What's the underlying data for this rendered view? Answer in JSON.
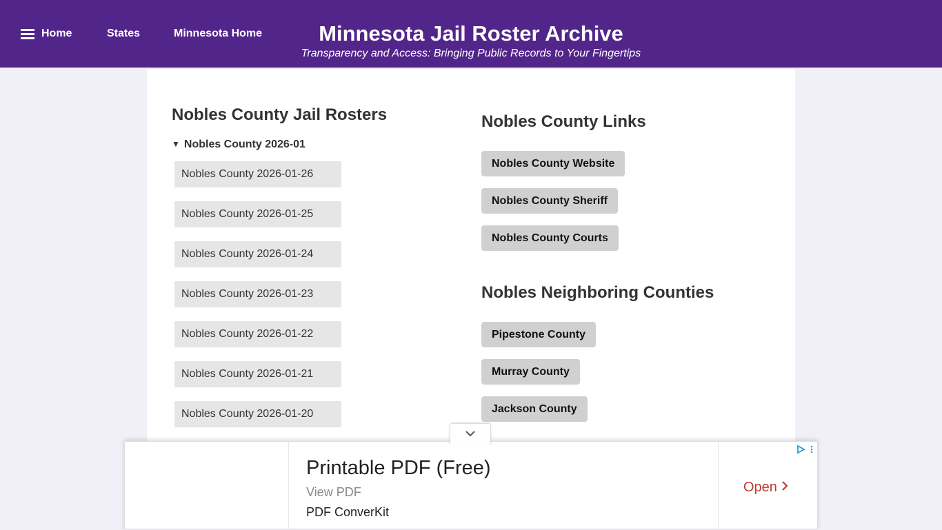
{
  "nav": {
    "home": "Home",
    "states": "States",
    "state_home": "Minnesota Home"
  },
  "header": {
    "title": "Minnesota Jail Roster Archive",
    "tagline": "Transparency and Access: Bringing Public Records to Your Fingertips"
  },
  "rosters": {
    "heading": "Nobles County Jail Rosters",
    "month": "Nobles County 2026-01",
    "items": [
      "Nobles County 2026-01-26",
      "Nobles County 2026-01-25",
      "Nobles County 2026-01-24",
      "Nobles County 2026-01-23",
      "Nobles County 2026-01-22",
      "Nobles County 2026-01-21",
      "Nobles County 2026-01-20"
    ]
  },
  "links": {
    "heading": "Nobles County Links",
    "items": [
      "Nobles County Website",
      "Nobles County Sheriff",
      "Nobles County Courts"
    ]
  },
  "neighbors": {
    "heading": "Nobles Neighboring Counties",
    "items": [
      "Pipestone County",
      "Murray County",
      "Jackson County"
    ]
  },
  "ad": {
    "headline": "Printable PDF (Free)",
    "sub": "View PDF",
    "advertiser": "PDF ConverKit",
    "cta": "Open"
  },
  "colors": {
    "header_bg": "#52258a",
    "page_bg": "#f1f0f8",
    "cta": "#c0392b"
  }
}
